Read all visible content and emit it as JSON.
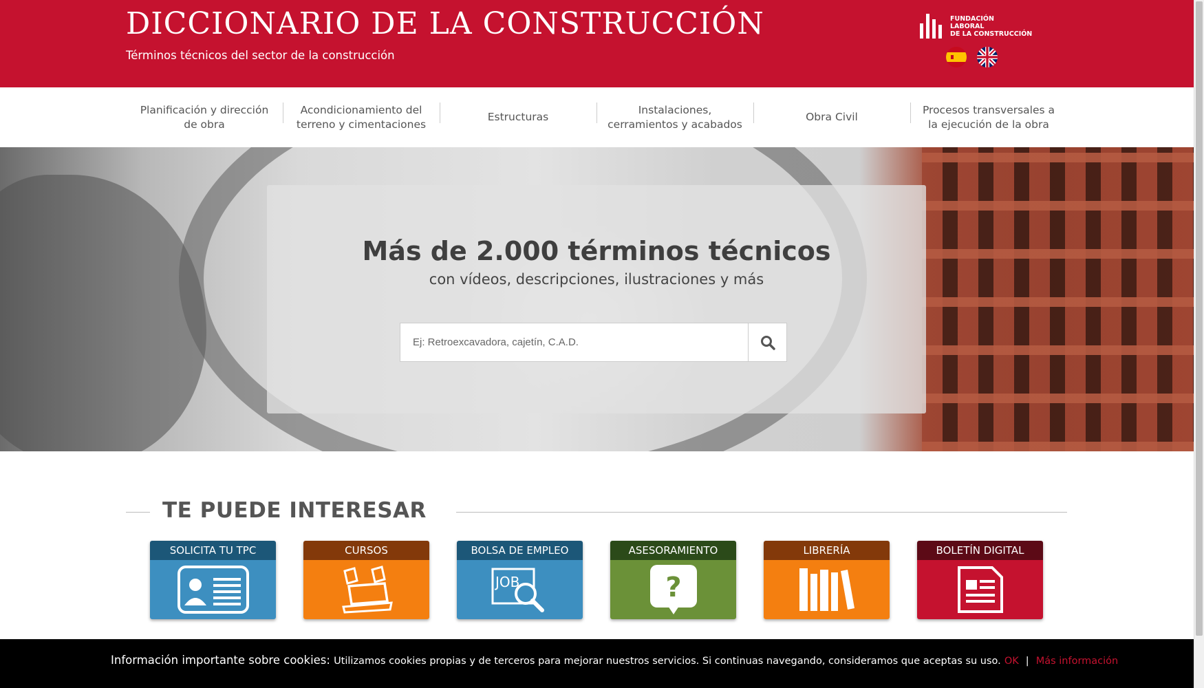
{
  "header": {
    "title": "DICCIONARIO DE LA CONSTRUCCIÓN",
    "subtitle": "Términos técnicos del sector de la construcción",
    "logo_lines": [
      "FUNDACIÓN",
      "LABORAL",
      "DE LA CONSTRUCCIÓN"
    ],
    "flags": [
      "spanish-flag-icon",
      "uk-flag-icon"
    ],
    "brand_color": "#c5122f"
  },
  "nav": {
    "items": [
      {
        "label": "Planificación y dirección de obra"
      },
      {
        "label": "Acondicionamiento del terreno y cimentaciones"
      },
      {
        "label": "Estructuras"
      },
      {
        "label": "Instalaciones, cerramientos y acabados"
      },
      {
        "label": "Obra Civil"
      },
      {
        "label": "Procesos transversales a la ejecución de la obra"
      }
    ]
  },
  "hero": {
    "title": "Más de 2.000 términos técnicos",
    "subtitle": "con vídeos, descripciones, ilustraciones y más",
    "search_placeholder": "Ej: Retroexcavadora, cajetín, C.A.D.",
    "search_icon": "search-icon"
  },
  "interest": {
    "title": "TE PUEDE INTERESAR",
    "cards": [
      {
        "label": "SOLICITA TU TPC",
        "icon": "id-card-icon",
        "head_color": "#1c5778",
        "body_color": "#3d8fc0"
      },
      {
        "label": "CURSOS",
        "icon": "books-laptop-icon",
        "head_color": "#83390a",
        "body_color": "#f47f10"
      },
      {
        "label": "BOLSA DE EMPLEO",
        "icon": "job-search-icon",
        "head_color": "#1c5778",
        "body_color": "#3d8fc0"
      },
      {
        "label": "ASESORAMIENTO",
        "icon": "question-bubble-icon",
        "head_color": "#2b4a19",
        "body_color": "#6b9138"
      },
      {
        "label": "LIBRERÍA",
        "icon": "bookshelf-icon",
        "head_color": "#83390a",
        "body_color": "#f47f10"
      },
      {
        "label": "BOLETÍN DIGITAL",
        "icon": "newsletter-icon",
        "head_color": "#5c0a16",
        "body_color": "#c5122f"
      }
    ]
  },
  "cookies": {
    "heading": "Información importante sobre cookies:",
    "text": "Utilizamos cookies propias y de terceros para mejorar nuestros servicios. Si continuas navegando, consideramos que aceptas su uso.",
    "ok_label": "OK",
    "separator": "|",
    "more_label": "Más información"
  }
}
